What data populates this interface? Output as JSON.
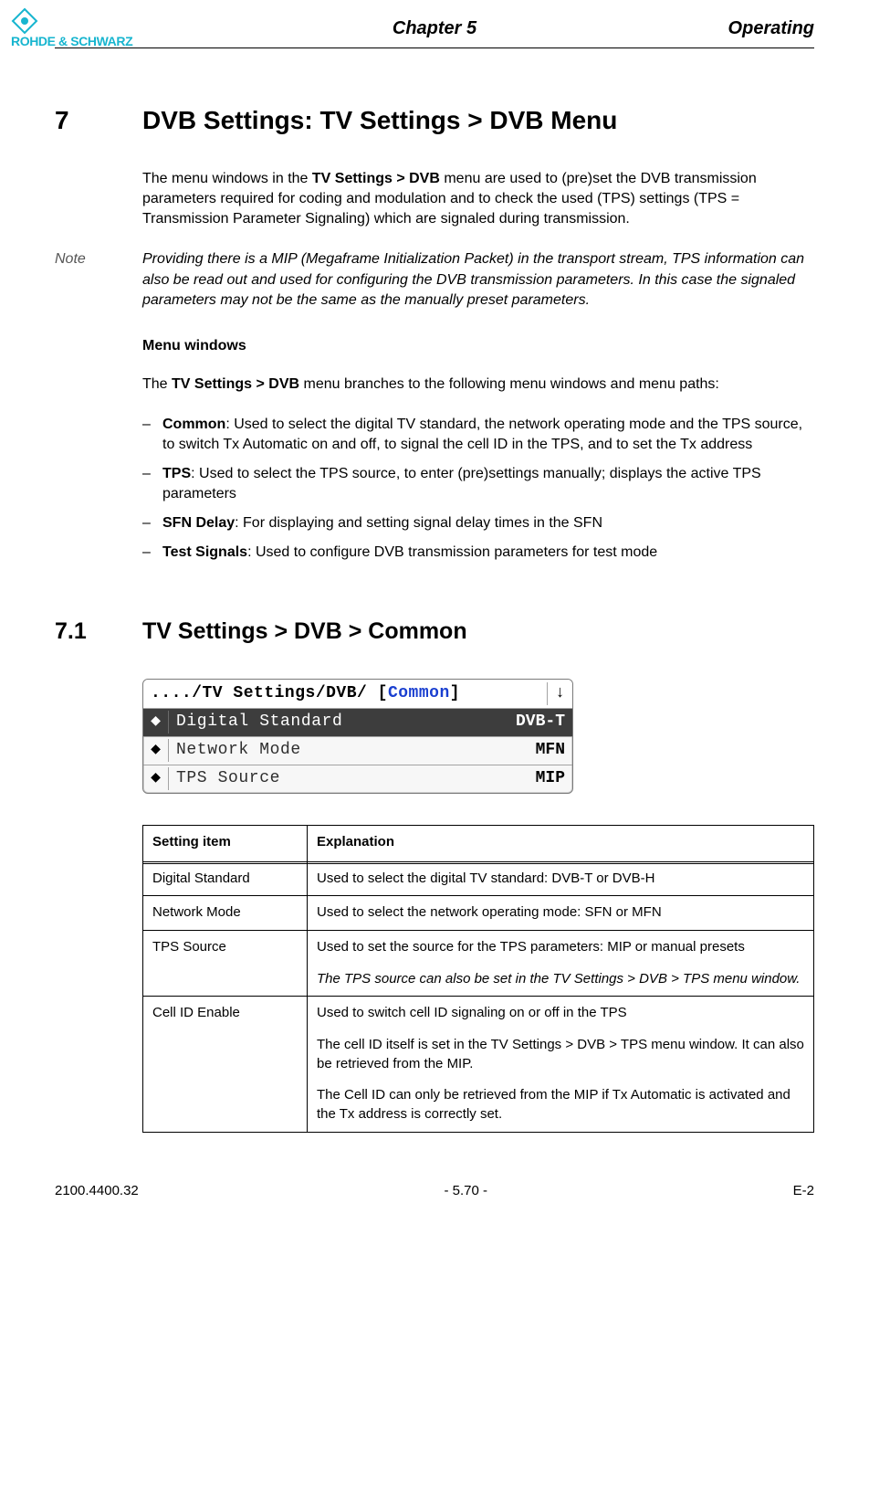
{
  "header": {
    "brand": "ROHDE & SCHWARZ",
    "chapter": "Chapter 5",
    "section": "Operating"
  },
  "s7": {
    "num": "7",
    "title": "DVB Settings: TV Settings > DVB Menu",
    "intro_pre": "The menu windows in the ",
    "intro_bold": "TV Settings > DVB",
    "intro_post": " menu are used to (pre)set the DVB transmission parameters required for coding and modulation and to check the used (TPS) settings (TPS = Transmission Parameter Signaling) which are signaled during transmission.",
    "note_label": "Note",
    "note_text": "Providing there is a MIP (Megaframe Initialization Packet) in the transport stream, TPS information can also be read out and used for configuring the DVB transmission parameters. In this case the signaled parameters may not be the same as the manually preset parameters.",
    "menu_windows_heading": "Menu windows",
    "branches_pre": "The ",
    "branches_bold": "TV Settings > DVB",
    "branches_post": " menu branches to the following menu windows and menu paths:",
    "items": [
      {
        "title": "Common",
        "text": ": Used to select the digital TV standard, the network operating mode and the TPS source, to switch Tx Automatic on and off, to signal the cell ID in the TPS, and to set the Tx address"
      },
      {
        "title": "TPS",
        "text": ": Used to select the TPS source, to enter (pre)settings manually; displays the active TPS parameters"
      },
      {
        "title": "SFN Delay",
        "text": ": For displaying and setting signal delay times in the SFN"
      },
      {
        "title": "Test Signals",
        "text": ": Used to configure DVB transmission parameters for test mode"
      }
    ]
  },
  "s71": {
    "num": "7.1",
    "title": "TV Settings > DVB > Common"
  },
  "screenshot": {
    "path_prefix": "..../TV Settings/DVB/ ",
    "path_common_open": "[",
    "path_common": "Common",
    "path_common_close": "]",
    "down_glyph": "↓",
    "spin_glyph": "◆",
    "rows": [
      {
        "label": "Digital Standard",
        "value": "DVB-T",
        "selected": true
      },
      {
        "label": "Network Mode",
        "value": "MFN",
        "selected": false
      },
      {
        "label": "TPS Source",
        "value": "MIP",
        "selected": false
      }
    ]
  },
  "table": {
    "headers": [
      "Setting item",
      "Explanation"
    ],
    "rows": [
      {
        "item": "Digital Standard",
        "paras": [
          {
            "text": "Used to select the digital TV standard: DVB-T or DVB-H",
            "italic": false
          }
        ]
      },
      {
        "item": "Network Mode",
        "paras": [
          {
            "text": "Used to select the network operating mode: SFN or MFN",
            "italic": false
          }
        ]
      },
      {
        "item": "TPS Source",
        "paras": [
          {
            "text": "Used to set the source for the TPS parameters: MIP or manual presets",
            "italic": false
          },
          {
            "text": "The TPS source can also be set in the TV Settings > DVB > TPS menu window.",
            "italic": true
          }
        ]
      },
      {
        "item": "Cell ID Enable",
        "paras": [
          {
            "text": "Used to switch cell ID signaling on or off in the TPS",
            "italic": false
          },
          {
            "text": "The cell ID itself is set in the TV Settings > DVB > TPS menu window. It can also be retrieved from the MIP.",
            "italic": false
          },
          {
            "text": "The Cell ID can only be retrieved from the MIP if Tx Automatic is activated and the Tx address is correctly set.",
            "italic": false
          }
        ]
      }
    ]
  },
  "footer": {
    "left": "2100.4400.32",
    "center": "- 5.70 -",
    "right": "E-2"
  }
}
